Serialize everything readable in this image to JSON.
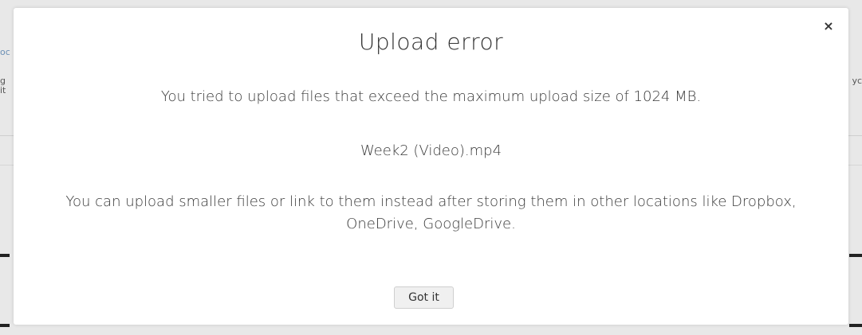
{
  "background": {
    "fragment_left_1": "oc",
    "fragment_left_2": "g",
    "fragment_left_3": "it",
    "fragment_right_1": "yc"
  },
  "dialog": {
    "title": "Upload error",
    "close_glyph": "×",
    "message_limit": "You tried to upload files that exceed the maximum upload size of 1024 MB.",
    "file_name": "Week2 (Video).mp4",
    "message_suggestion": "You can upload smaller files or link to them instead after storing them in other locations like Dropbox, OneDrive, GoogleDrive.",
    "confirm_label": "Got it"
  }
}
